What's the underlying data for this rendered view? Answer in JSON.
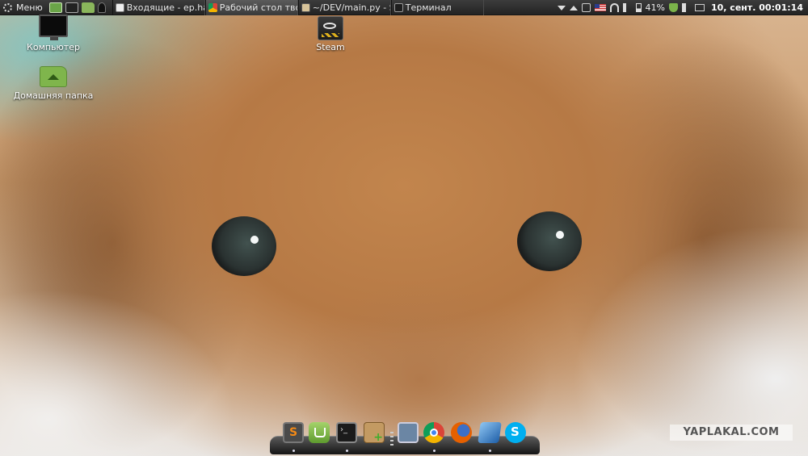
{
  "panel": {
    "menu_label": "Меню",
    "launchers": [
      {
        "icon": "monitor-icon"
      },
      {
        "icon": "terminal-icon"
      },
      {
        "icon": "folder-icon"
      },
      {
        "icon": "spy-icon"
      }
    ],
    "tasks": [
      {
        "label": "Входящие - ep.hao...",
        "icon": "mail-icon",
        "active": false
      },
      {
        "label": "Рабочий стол твор...",
        "icon": "chrome-icon",
        "active": true
      },
      {
        "label": "~/DEV/main.py - S...",
        "icon": "editor-icon",
        "active": false
      },
      {
        "label": "Терминал",
        "icon": "terminal-icon",
        "active": false
      }
    ],
    "tray": {
      "battery_percent": "41%",
      "clock": "10, сент. 00:01:14",
      "icons": [
        "download-icon",
        "upload-icon",
        "clipboard-icon",
        "us-flag-icon",
        "wifi-icon",
        "volume-icon",
        "battery-icon",
        "shield-icon",
        "speaker-icon",
        "keyboard-icon"
      ]
    }
  },
  "desktop": {
    "icons": [
      {
        "label": "Компьютер",
        "icon": "computer-icon"
      },
      {
        "label": "Домашняя папка",
        "icon": "home-folder-icon"
      },
      {
        "label": "Steam",
        "icon": "steam-icon"
      }
    ]
  },
  "dock": {
    "items": [
      "sublime-text-icon",
      "mint-install-icon",
      "terminal-icon",
      "package-installer-icon",
      "virtualbox-icon",
      "chrome-icon",
      "firefox-icon",
      "mail-client-icon",
      "skype-icon"
    ]
  },
  "watermark": "YAPLAKAL.COM"
}
